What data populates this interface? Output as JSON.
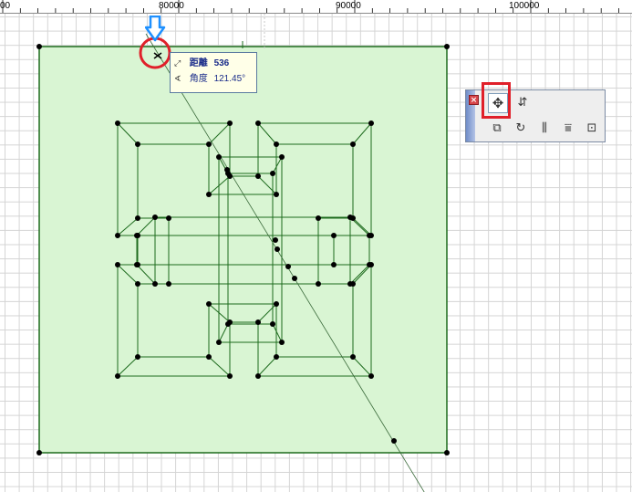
{
  "ruler": {
    "labels": [
      {
        "text": "00"
      },
      {
        "text": "80000"
      },
      {
        "text": "90000"
      },
      {
        "text": "100000"
      }
    ]
  },
  "tooltip": {
    "distance_icon": "distance-icon",
    "distance_label": "距離",
    "distance_value": "536",
    "angle_icon": "angle-icon",
    "angle_label": "角度",
    "angle_value": "121.45°"
  },
  "palette": {
    "close_icon": "close-icon",
    "buttons": [
      {
        "name": "move-icon",
        "glyph": "✥",
        "selected": true
      },
      {
        "name": "elevate-icon",
        "glyph": "⇵"
      },
      {
        "name": "drag-copy-icon",
        "glyph": "⧉"
      },
      {
        "name": "rotate-icon",
        "glyph": "↻"
      },
      {
        "name": "mirror-icon",
        "glyph": "⫼"
      },
      {
        "name": "multiply-icon",
        "glyph": "⩸"
      },
      {
        "name": "offset-icon",
        "glyph": "⊡"
      }
    ]
  },
  "colors": {
    "fill": "#d9f5d3",
    "line": "#1d6b1d",
    "highlight": "#e0202a",
    "arrow": "#1e90ff",
    "tooltip_bg": "#ffffe8",
    "tooltip_text": "#1b2d8a"
  }
}
